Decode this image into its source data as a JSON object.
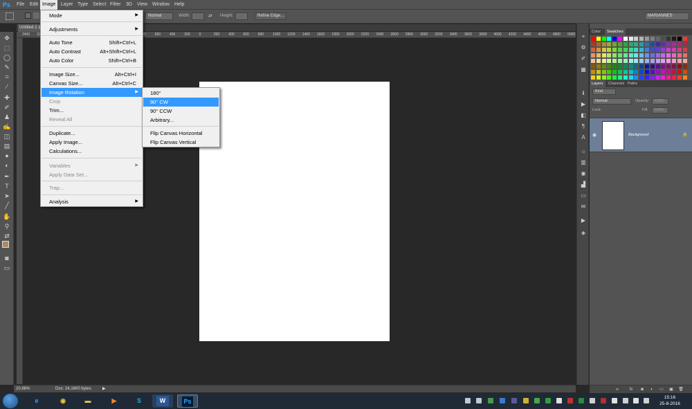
{
  "menubar": {
    "logo": "Ps",
    "items": [
      "File",
      "Edit",
      "Image",
      "Layer",
      "Type",
      "Select",
      "Filter",
      "3D",
      "View",
      "Window",
      "Help"
    ]
  },
  "options_bar": {
    "style_value": "Normal",
    "width_label": "Width:",
    "height_label": "Height:",
    "refine_edge": "Refine Edge...",
    "workspace": "MARIANNES"
  },
  "document": {
    "tab_label": "Untitled-1 @",
    "zoom": "20,66%",
    "doc_info": "Doc: 24,1M/0 bytes"
  },
  "ruler": {
    "ticks": [
      "2400",
      "2200",
      "2000",
      "1800",
      "1600",
      "1400",
      "1200",
      "1000",
      "800",
      "600",
      "400",
      "200",
      "0",
      "200",
      "400",
      "600",
      "800",
      "1000",
      "1200",
      "1400",
      "1600",
      "1800",
      "2000",
      "2200",
      "2400",
      "2600",
      "2800",
      "3000",
      "3200",
      "3400",
      "3600",
      "3800",
      "4000",
      "4200",
      "4400",
      "4600",
      "4800",
      "5000"
    ]
  },
  "image_menu": {
    "items": [
      {
        "label": "Mode",
        "shortcut": "",
        "submenu": true,
        "disabled": false
      },
      {
        "label": "Adjustments",
        "shortcut": "",
        "submenu": true,
        "disabled": false
      },
      {
        "label": "Auto Tone",
        "shortcut": "Shift+Ctrl+L",
        "submenu": false,
        "disabled": false
      },
      {
        "label": "Auto Contrast",
        "shortcut": "Alt+Shift+Ctrl+L",
        "submenu": false,
        "disabled": false
      },
      {
        "label": "Auto Color",
        "shortcut": "Shift+Ctrl+B",
        "submenu": false,
        "disabled": false
      },
      {
        "label": "Image Size...",
        "shortcut": "Alt+Ctrl+I",
        "submenu": false,
        "disabled": false
      },
      {
        "label": "Canvas Size...",
        "shortcut": "Alt+Ctrl+C",
        "submenu": false,
        "disabled": false
      },
      {
        "label": "Image Rotation",
        "shortcut": "",
        "submenu": true,
        "disabled": false
      },
      {
        "label": "Crop",
        "shortcut": "",
        "submenu": false,
        "disabled": true
      },
      {
        "label": "Trim...",
        "shortcut": "",
        "submenu": false,
        "disabled": false
      },
      {
        "label": "Reveal All",
        "shortcut": "",
        "submenu": false,
        "disabled": true
      },
      {
        "label": "Duplicate...",
        "shortcut": "",
        "submenu": false,
        "disabled": false
      },
      {
        "label": "Apply Image...",
        "shortcut": "",
        "submenu": false,
        "disabled": false
      },
      {
        "label": "Calculations...",
        "shortcut": "",
        "submenu": false,
        "disabled": false
      },
      {
        "label": "Variables",
        "shortcut": "",
        "submenu": true,
        "disabled": true
      },
      {
        "label": "Apply Data Set...",
        "shortcut": "",
        "submenu": false,
        "disabled": true
      },
      {
        "label": "Trap...",
        "shortcut": "",
        "submenu": false,
        "disabled": true
      },
      {
        "label": "Analysis",
        "shortcut": "",
        "submenu": true,
        "disabled": false
      }
    ]
  },
  "rotation_menu": {
    "items": [
      "180°",
      "90° CW",
      "90° CCW",
      "Arbitrary...",
      "Flip Canvas Horizontal",
      "Flip Canvas Vertical"
    ],
    "highlighted": "90° CW"
  },
  "panels": {
    "color_tabs": [
      "Color",
      "Swatches"
    ],
    "layers_tabs": [
      "Layers",
      "Channels",
      "Paths"
    ],
    "kind_label": "Kind",
    "blend_mode": "Normal",
    "opacity_label": "Opacity:",
    "opacity_value": "100%",
    "lock_label": "Lock:",
    "fill_label": "Fill:",
    "fill_value": "100%",
    "layer_name": "Background"
  },
  "taskbar": {
    "time": "15:16",
    "date": "25-8-2016",
    "ps_label": "Ps",
    "word_label": "W"
  },
  "colors": {
    "accent": "#3399ff",
    "layer_selected": "#6d7f98",
    "canvas": "#ffffff"
  }
}
